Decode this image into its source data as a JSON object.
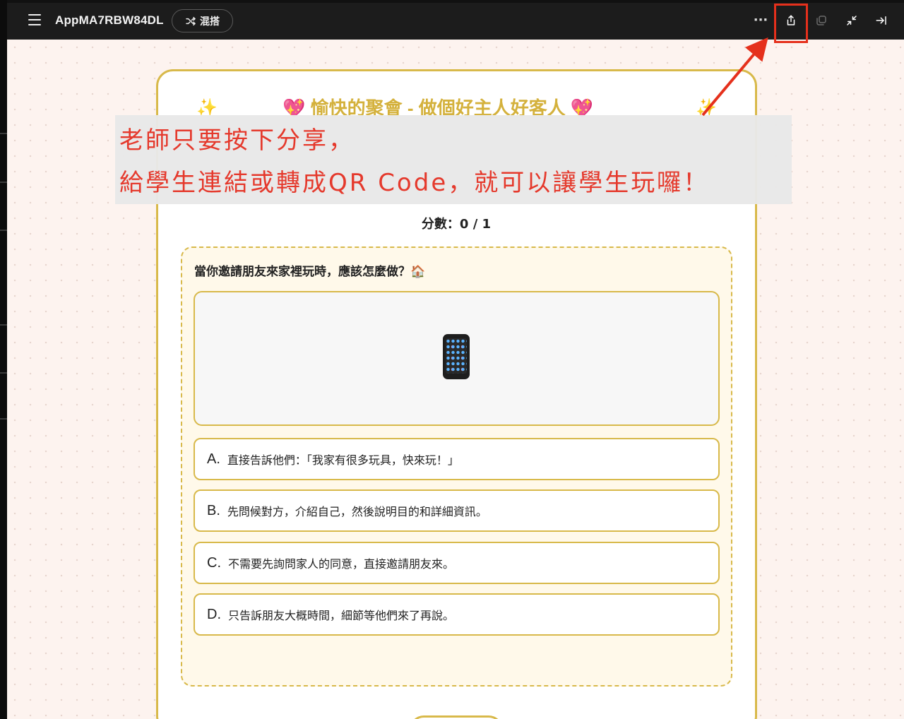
{
  "toolbar": {
    "app_title": "AppMA7RBW84DL",
    "mix_label": "混搭",
    "more_label": "···"
  },
  "quiz": {
    "title": "💖 愉快的聚會 - 做個好主人好客人 💖",
    "sparkle": "✨",
    "score": "分數：0 / 1",
    "question": "當你邀請朋友來家裡玩時，應該怎麼做？🏠",
    "options": [
      {
        "letter": "A.",
        "text": "直接告訴他們：「我家有很多玩具，快來玩！」"
      },
      {
        "letter": "B.",
        "text": "先問候對方，介紹自己，然後說明目的和詳細資訊。"
      },
      {
        "letter": "C.",
        "text": "不需要先詢問家人的同意，直接邀請朋友來。"
      },
      {
        "letter": "D.",
        "text": "只告訴朋友大概時間，細節等他們來了再說。"
      }
    ]
  },
  "annotation": {
    "line1": "老師只要按下分享，",
    "line2": "給學生連結或轉成QR Code，就可以讓學生玩囉！",
    "color": "#e5392c"
  },
  "icons": [
    "menu-icon",
    "shuffle-icon",
    "more-icon",
    "share-icon",
    "copy-icon",
    "collapse-icon",
    "dock-right-icon",
    "phone-icon"
  ]
}
